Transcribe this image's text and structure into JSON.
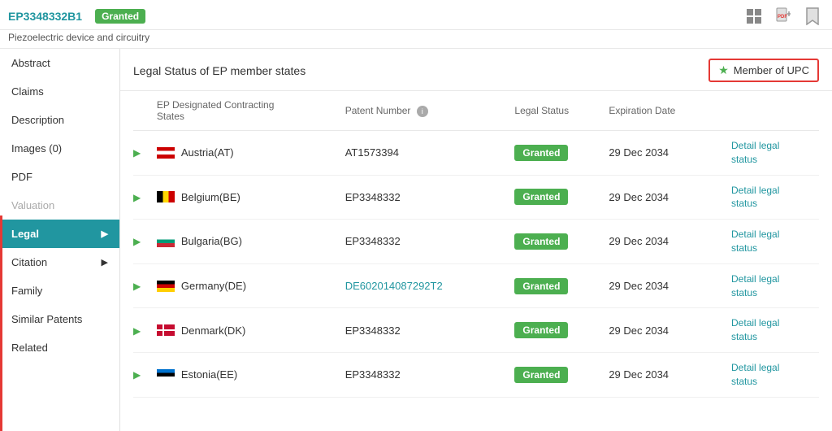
{
  "header": {
    "patent_id": "EP3348332B1",
    "granted_label": "Granted",
    "patent_title": "Piezoelectric device and circuitry",
    "icons": [
      "grid-icon",
      "pdf-icon",
      "bookmark-icon"
    ]
  },
  "sidebar": {
    "items": [
      {
        "label": "Abstract",
        "active": false,
        "has_arrow": false
      },
      {
        "label": "Claims",
        "active": false,
        "has_arrow": false
      },
      {
        "label": "Description",
        "active": false,
        "has_arrow": false
      },
      {
        "label": "Images (0)",
        "active": false,
        "has_arrow": false
      },
      {
        "label": "PDF",
        "active": false,
        "has_arrow": false
      },
      {
        "label": "Valuation",
        "active": false,
        "has_arrow": false
      },
      {
        "label": "Legal",
        "active": true,
        "has_arrow": true
      },
      {
        "label": "Citation",
        "active": false,
        "has_arrow": true
      },
      {
        "label": "Family",
        "active": false,
        "has_arrow": false
      },
      {
        "label": "Similar Patents",
        "active": false,
        "has_arrow": false
      },
      {
        "label": "Related",
        "active": false,
        "has_arrow": false
      }
    ]
  },
  "legal": {
    "section_title": "Legal Status of EP member states",
    "member_upc_label": "Member of UPC",
    "table": {
      "columns": [
        "EP Designated Contracting States",
        "Patent Number",
        "Legal Status",
        "Expiration Date",
        ""
      ],
      "rows": [
        {
          "country": "Austria(AT)",
          "flag": "at",
          "patent": "AT1573394",
          "patent_link": false,
          "status": "Granted",
          "expiry": "29 Dec 2034",
          "detail": "Detail legal status"
        },
        {
          "country": "Belgium(BE)",
          "flag": "be",
          "patent": "EP3348332",
          "patent_link": false,
          "status": "Granted",
          "expiry": "29 Dec 2034",
          "detail": "Detail legal status"
        },
        {
          "country": "Bulgaria(BG)",
          "flag": "bg",
          "patent": "EP3348332",
          "patent_link": false,
          "status": "Granted",
          "expiry": "29 Dec 2034",
          "detail": "Detail legal status"
        },
        {
          "country": "Germany(DE)",
          "flag": "de",
          "patent": "DE602014087292T2",
          "patent_link": true,
          "status": "Granted",
          "expiry": "29 Dec 2034",
          "detail": "Detail legal status"
        },
        {
          "country": "Denmark(DK)",
          "flag": "dk",
          "patent": "EP3348332",
          "patent_link": false,
          "status": "Granted",
          "expiry": "29 Dec 2034",
          "detail": "Detail legal status"
        },
        {
          "country": "Estonia(EE)",
          "flag": "ee",
          "patent": "EP3348332",
          "patent_link": false,
          "status": "Granted",
          "expiry": "29 Dec 2034",
          "detail": "Detail legal status"
        }
      ]
    }
  }
}
